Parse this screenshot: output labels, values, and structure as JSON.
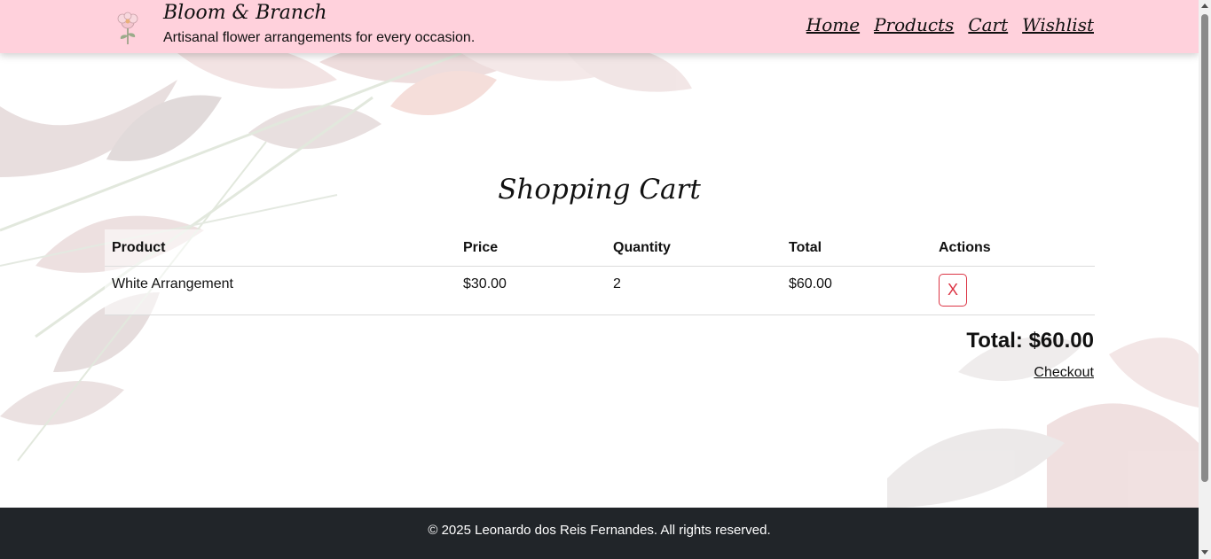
{
  "header": {
    "brand_name": "Bloom & Branch",
    "tagline": "Artisanal flower arrangements for every occasion.",
    "logo_icon": "flower-logo-icon",
    "nav": [
      {
        "label": "Home"
      },
      {
        "label": "Products"
      },
      {
        "label": "Cart"
      },
      {
        "label": "Wishlist"
      }
    ]
  },
  "cart": {
    "title": "Shopping Cart",
    "columns": {
      "product": "Product",
      "price": "Price",
      "quantity": "Quantity",
      "total": "Total",
      "actions": "Actions"
    },
    "items": [
      {
        "product": "White Arrangement",
        "price": "$30.00",
        "quantity": "2",
        "total": "$60.00",
        "remove_label": "X"
      }
    ],
    "grand_total": "Total: $60.00",
    "checkout_label": "Checkout"
  },
  "footer": {
    "copyright": "© 2025 Leonardo dos Reis Fernandes. All rights reserved."
  },
  "colors": {
    "header_bg": "#ffd1dc",
    "footer_bg": "#212529",
    "remove_button": "#dc3545"
  }
}
